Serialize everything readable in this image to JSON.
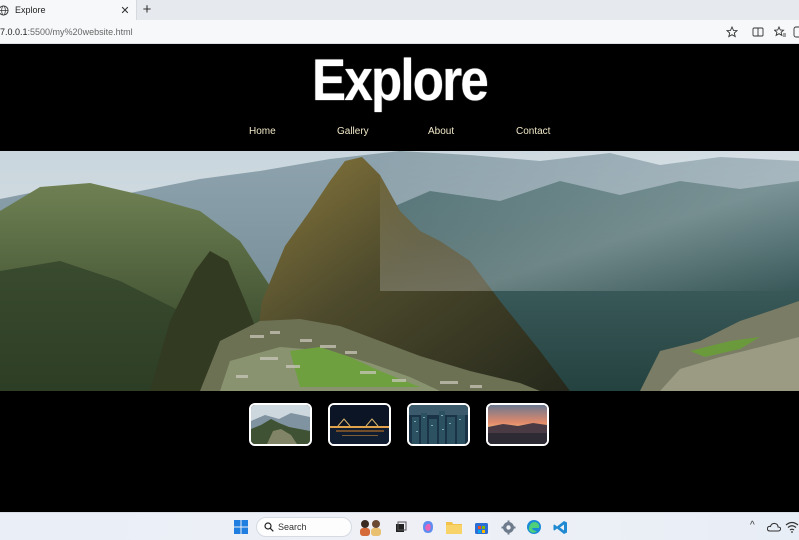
{
  "browser": {
    "tab_title": "Explore",
    "close_glyph": "✕",
    "new_tab_glyph": "+",
    "url_host": "7.0.0.1",
    "url_rest": ":5500/my%20website.html"
  },
  "site": {
    "title": "Explore",
    "nav": [
      "Home",
      "Gallery",
      "About",
      "Contact"
    ],
    "nav_color": "#f1e8c8"
  },
  "gallery": {
    "thumbnails": [
      "mountain-valley",
      "city-bridge-night",
      "city-skyline-night",
      "sunset-sea"
    ]
  },
  "taskbar": {
    "search_label": "Search",
    "tray_chevron": "^"
  }
}
